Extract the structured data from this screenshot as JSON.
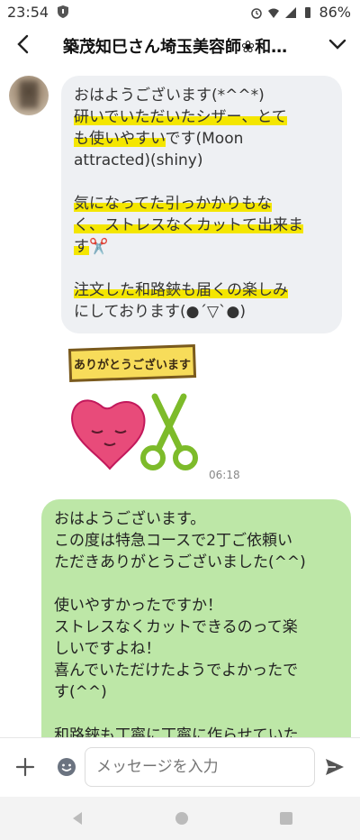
{
  "status": {
    "time": "23:54",
    "battery": "86%"
  },
  "header": {
    "title": "築茂知巳さん埼玉美容師❀和…"
  },
  "incoming": {
    "lines": [
      "おはようございます(*^^*)",
      "研いでいただいたシザー、とて",
      "も使いやす",
      "い",
      "です(Moon",
      "attracted)(shiny)",
      "気になってた引っかかりもな",
      "く、ストレスなくカットて出来ま",
      "す",
      "✂️",
      "注文した和路鋏も届くの楽しみ",
      "にしております(●´▽`●)"
    ]
  },
  "stamp": {
    "text": "ありがとうございます",
    "time": "06:18"
  },
  "outgoing": {
    "lines": [
      "おはようございます。",
      "この度は特急コースで2丁ご依頼い",
      "ただきありがとうございました(^^)",
      "使いやすかったですか！",
      "ストレスなくカットできるのって楽",
      "しいですよね！",
      "喜んでいただけたようでよかったで",
      "す(^^)",
      "和路鋏も丁寧に丁寧に作らせていた"
    ]
  },
  "input": {
    "placeholder": "メッセージを入力"
  }
}
